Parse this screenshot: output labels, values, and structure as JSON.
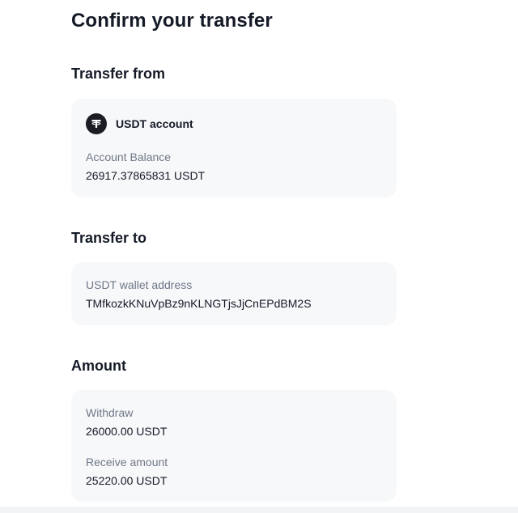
{
  "page": {
    "title": "Confirm your transfer"
  },
  "transfer_from": {
    "heading": "Transfer from",
    "account_icon": "tether-icon",
    "account_name": "USDT account",
    "balance_label": "Account Balance",
    "balance_value": "26917.37865831 USDT"
  },
  "transfer_to": {
    "heading": "Transfer to",
    "address_label": "USDT wallet address",
    "address_value": "TMfkozkKNuVpBz9nKLNGTjsJjCnEPdBM2S"
  },
  "amount": {
    "heading": "Amount",
    "withdraw_label": "Withdraw",
    "withdraw_value": "26000.00 USDT",
    "receive_label": "Receive amount",
    "receive_value": "25220.00 USDT"
  },
  "colors": {
    "text_primary": "#141a26",
    "text_secondary": "#6e7787",
    "card_background": "#f7f8fa",
    "icon_background": "#1a1d24"
  }
}
